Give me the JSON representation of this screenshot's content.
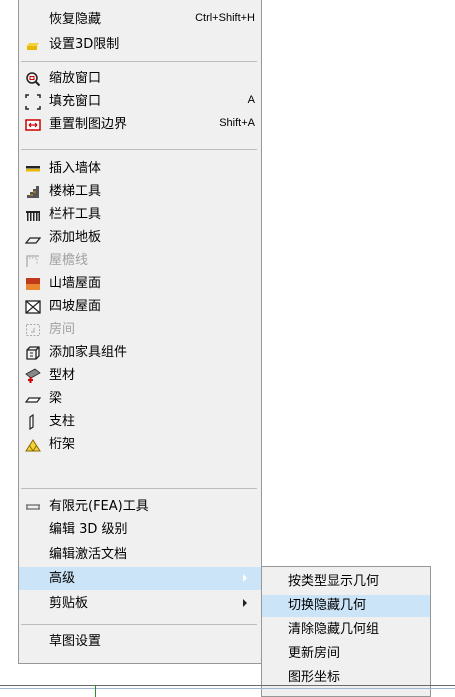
{
  "menu": {
    "items": [
      {
        "label": "恢复隐藏",
        "shortcut": "Ctrl+Shift+H",
        "icon": "none",
        "disabled": false
      },
      {
        "label": "设置3D限制",
        "shortcut": "",
        "icon": "yellow-box-icon",
        "disabled": false
      },
      {
        "label": "缩放窗口",
        "shortcut": "",
        "icon": "zoom-window-icon",
        "disabled": false
      },
      {
        "label": "填充窗口",
        "shortcut": "A",
        "icon": "fill-window-icon",
        "disabled": false
      },
      {
        "label": "重置制图边界",
        "shortcut": "Shift+A",
        "icon": "reset-bounds-icon",
        "disabled": false
      },
      {
        "label": "插入墙体",
        "shortcut": "",
        "icon": "wall-icon",
        "disabled": false
      },
      {
        "label": "楼梯工具",
        "shortcut": "",
        "icon": "stair-icon",
        "disabled": false
      },
      {
        "label": "栏杆工具",
        "shortcut": "",
        "icon": "railing-icon",
        "disabled": false
      },
      {
        "label": "添加地板",
        "shortcut": "",
        "icon": "floor-icon",
        "disabled": false
      },
      {
        "label": "屋檐线",
        "shortcut": "",
        "icon": "eave-icon",
        "disabled": true
      },
      {
        "label": "山墙屋面",
        "shortcut": "",
        "icon": "gable-roof-icon",
        "disabled": false
      },
      {
        "label": "四坡屋面",
        "shortcut": "",
        "icon": "hip-roof-icon",
        "disabled": false
      },
      {
        "label": "房间",
        "shortcut": "",
        "icon": "room-icon",
        "disabled": true
      },
      {
        "label": "添加家具组件",
        "shortcut": "",
        "icon": "furniture-icon",
        "disabled": false
      },
      {
        "label": "型材",
        "shortcut": "",
        "icon": "profile-icon",
        "disabled": false
      },
      {
        "label": "梁",
        "shortcut": "",
        "icon": "beam-icon",
        "disabled": false
      },
      {
        "label": "支柱",
        "shortcut": "",
        "icon": "column-icon",
        "disabled": false
      },
      {
        "label": "桁架",
        "shortcut": "",
        "icon": "truss-icon",
        "disabled": false
      },
      {
        "label": "有限元(FEA)工具",
        "shortcut": "",
        "icon": "fea-icon",
        "disabled": false
      },
      {
        "label": "编辑 3D 级别",
        "shortcut": "",
        "icon": "none",
        "disabled": false
      },
      {
        "label": "编辑激活文档",
        "shortcut": "",
        "icon": "none",
        "disabled": false
      },
      {
        "label": "高级",
        "shortcut": "",
        "icon": "none",
        "disabled": false,
        "submenu": true,
        "highlighted": true
      },
      {
        "label": "剪贴板",
        "shortcut": "",
        "icon": "none",
        "disabled": false,
        "submenu": true
      },
      {
        "label": "草图设置",
        "shortcut": "",
        "icon": "none",
        "disabled": false
      }
    ]
  },
  "submenu": {
    "items": [
      {
        "label": "按类型显示几何"
      },
      {
        "label": "切换隐藏几何",
        "highlighted": true
      },
      {
        "label": "清除隐藏几何组"
      },
      {
        "label": "更新房间"
      },
      {
        "label": "图形坐标"
      }
    ]
  }
}
